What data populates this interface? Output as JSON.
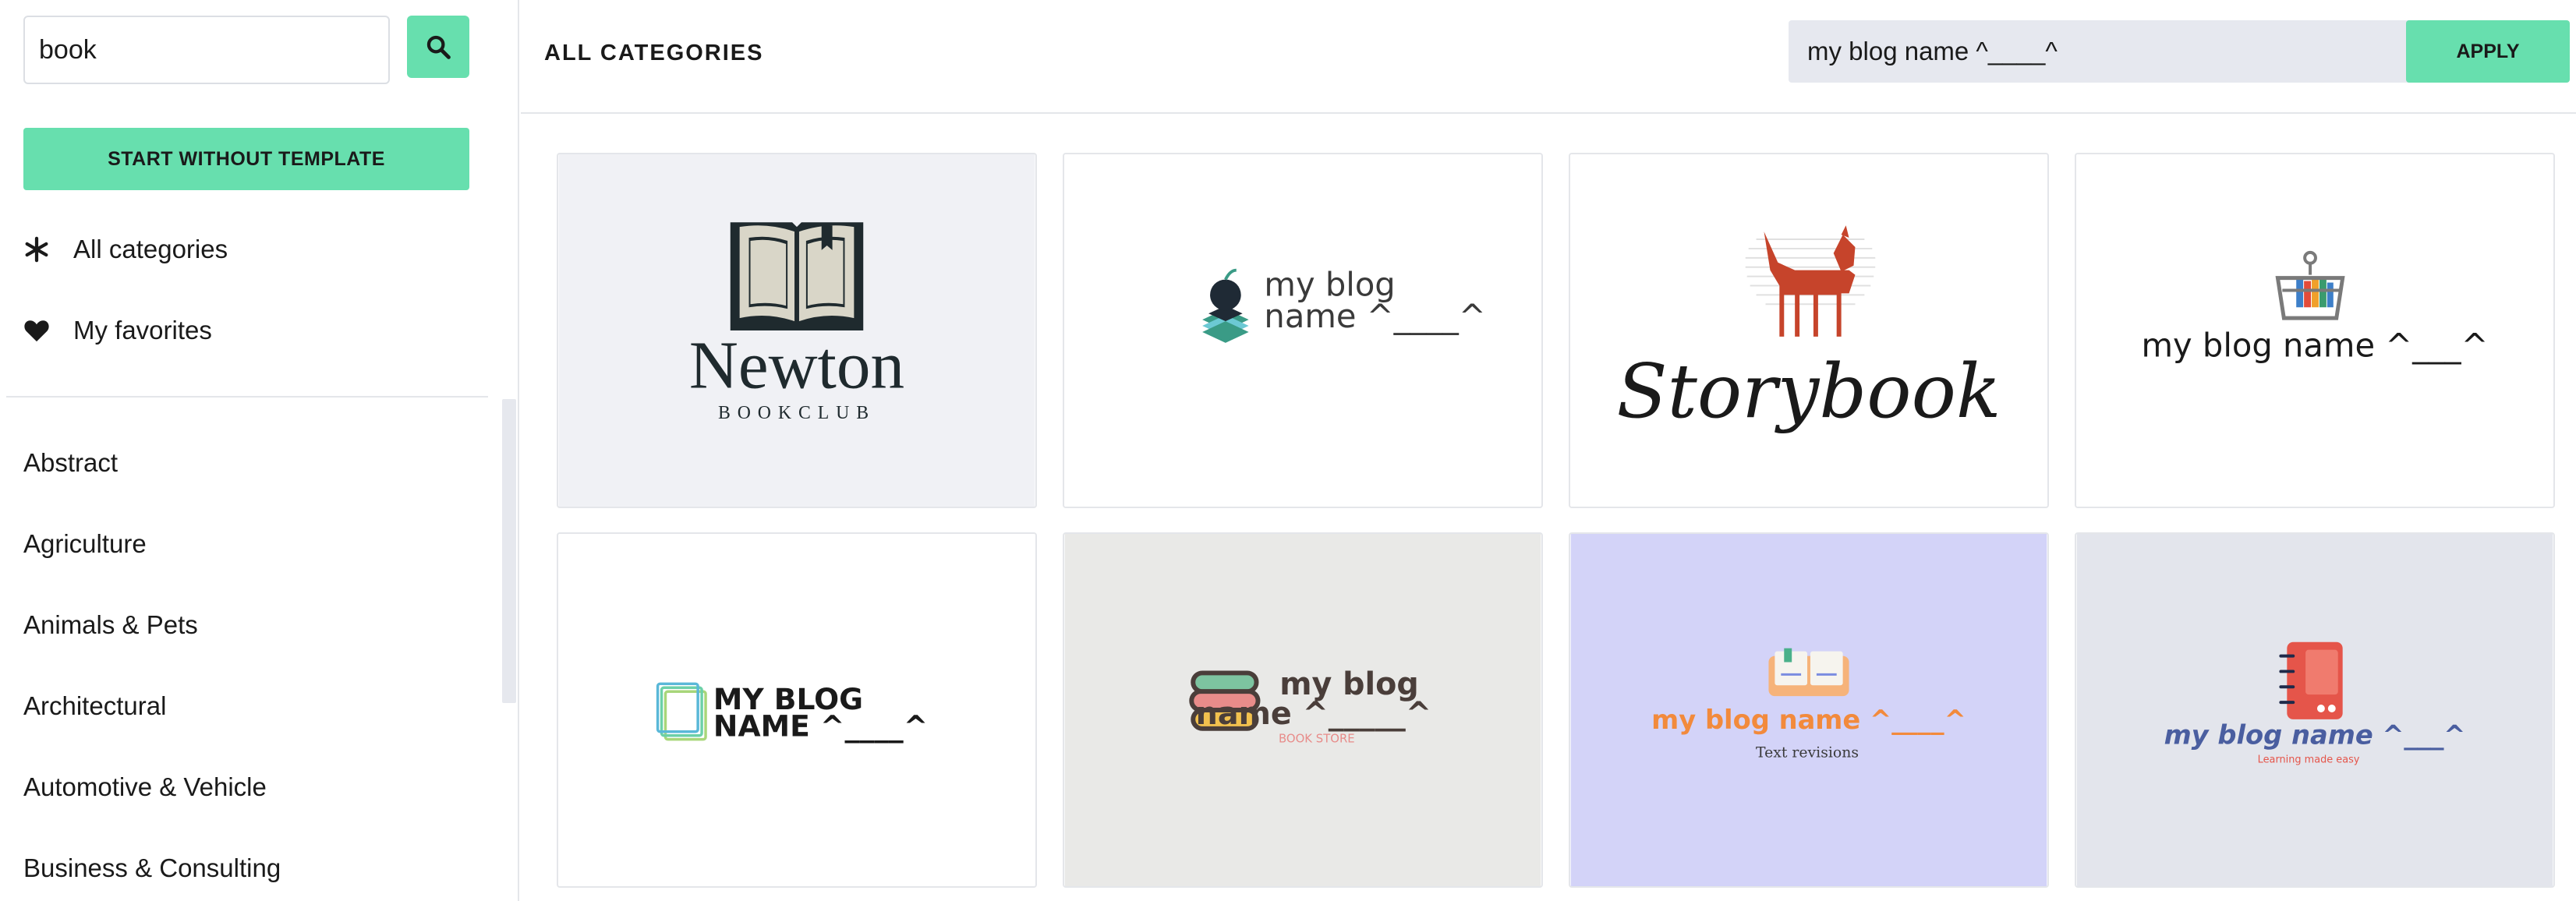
{
  "sidebar": {
    "search_value": "book",
    "start_label": "START WITHOUT TEMPLATE",
    "nav": [
      {
        "label": "All categories",
        "icon": "asterisk-icon"
      },
      {
        "label": "My favorites",
        "icon": "heart-icon"
      }
    ],
    "categories": [
      "Abstract",
      "Agriculture",
      "Animals & Pets",
      "Architectural",
      "Automotive & Vehicle",
      "Business & Consulting"
    ]
  },
  "header": {
    "title": "ALL CATEGORIES",
    "name_value": "my blog name ^____^",
    "apply_label": "APPLY"
  },
  "cards": [
    {
      "bg": "#f0f1f5",
      "texts": [
        "Newton",
        "BOOKCLUB"
      ]
    },
    {
      "bg": "#ffffff",
      "texts": [
        "my blog",
        "name ^____^"
      ]
    },
    {
      "bg": "#ffffff",
      "texts": [
        "Storybook"
      ]
    },
    {
      "bg": "#ffffff",
      "texts": [
        "my blog name ^___^"
      ]
    },
    {
      "bg": "#ffffff",
      "texts": [
        "MY BLOG",
        "NAME ^____^"
      ]
    },
    {
      "bg": "#e9e9e7",
      "texts": [
        "my blog",
        "name ^_____^",
        "BOOK STORE"
      ]
    },
    {
      "bg": "#d3d3f8",
      "texts": [
        "my blog name ^____^",
        "Text revisions"
      ]
    },
    {
      "bg": "#e3e5ec",
      "texts": [
        "my blog name ^___^",
        "Learning made easy"
      ]
    }
  ],
  "colors": {
    "accent": "#67dfae",
    "border": "#e4e6ea",
    "input_bg": "#e6e8ef"
  }
}
